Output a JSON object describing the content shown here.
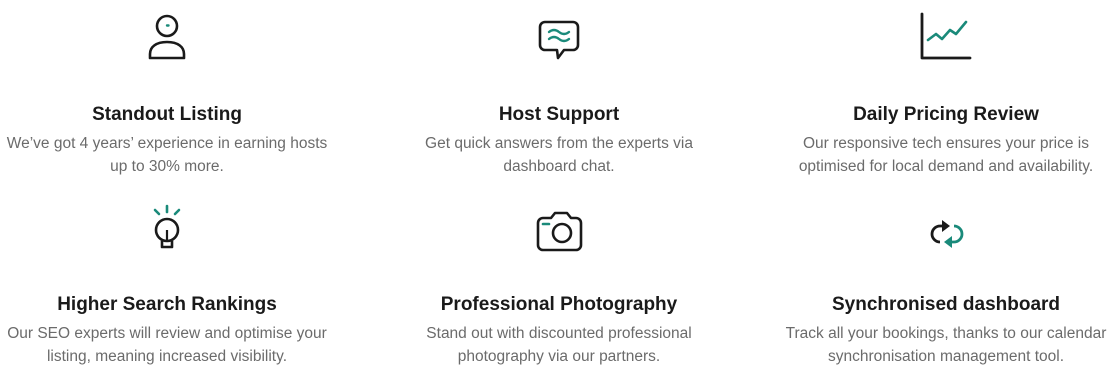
{
  "features": [
    {
      "icon": "person-icon",
      "title": "Standout Listing",
      "description": "We’ve got 4 years’ experience in earning hosts up to 30% more."
    },
    {
      "icon": "chat-bubble-icon",
      "title": "Host Support",
      "description": "Get quick answers from the experts via dashboard chat."
    },
    {
      "icon": "chart-line-icon",
      "title": "Daily Pricing Review",
      "description": "Our responsive tech ensures your price is optimised for local demand and availability."
    },
    {
      "icon": "lightbulb-icon",
      "title": "Higher Search Rankings",
      "description": "Our SEO experts will review and optimise your listing, meaning increased visibility."
    },
    {
      "icon": "camera-icon",
      "title": "Professional Photography",
      "description": "Stand out with discounted professional photography via our partners."
    },
    {
      "icon": "sync-arrows-icon",
      "title": "Synchronised dashboard",
      "description": "Track all your bookings, thanks to our calendar synchronisation management tool."
    }
  ],
  "colors": {
    "accent": "#1a8a7a",
    "icon_stroke": "#1a1a1a",
    "title": "#1a1a1a",
    "description": "#6b6b6b"
  }
}
